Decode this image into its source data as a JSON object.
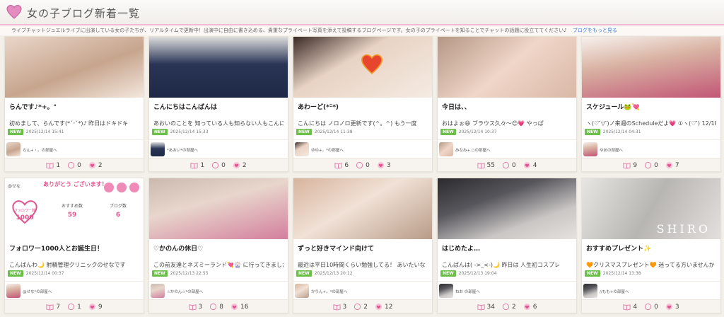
{
  "header": {
    "title": "女の子ブログ新着一覧"
  },
  "notice": {
    "text": "ライブチャットジュエルライブに出演している女の子たちが、リアルタイムで更新中！出演中に自由に書き込める、貴重なプライベート写真を添えて投稿するブログページです。女の子のプライベートを知ることでチャットの話題に役立ててください♪",
    "link": "ブログをもっと見る"
  },
  "posts": [
    {
      "title": "らんです♪*+。°",
      "excerpt": "初めまして、らんです(*ˊᵕˋ*)♪ 昨日はドキドキ",
      "badge": "NEW",
      "date": "2025/12/14 15:41",
      "author": "らん+・。の部屋へ",
      "views": "1",
      "comments": "0",
      "likes": "2"
    },
    {
      "title": "こんにちはこんばんは",
      "excerpt": "あおいのことを 知っている人も知らない人もこんに",
      "badge": "NEW",
      "date": "2025/12/14 15:33",
      "author": "*あおい*の部屋へ",
      "views": "1",
      "comments": "0",
      "likes": "2"
    },
    {
      "title": "あわーど(*ᵕ̈*)",
      "excerpt": "こんにちは ノロノロ更新です(^。^) もう一度",
      "badge": "NEW",
      "date": "2025/12/14 11:38",
      "author": "ゆゆ+。*の部屋へ",
      "views": "6",
      "comments": "0",
      "likes": "3"
    },
    {
      "title": "今日は、、",
      "excerpt": "おはよぉ😆 ブラウス久々～😊💗 やっぱ",
      "badge": "NEW",
      "date": "2025/12/14 10:37",
      "author": "みなみ+.○の部屋へ",
      "views": "55",
      "comments": "0",
      "likes": "4"
    },
    {
      "title": "スケジュール🐸💘",
      "excerpt": "ヽ(♡ ̄▽ ̄)ノ来週のScheduleだよ💗 ①ヽ(♡ ̄) 12/18日",
      "badge": "NEW",
      "date": "2025/12/14 04:31",
      "author": "ゆあの部屋へ",
      "views": "9",
      "comments": "0",
      "likes": "7"
    },
    {
      "title": "フォロワー1000人とお誕生日！",
      "excerpt": "こんばんわ🌙 射精管理クリニックのせなです",
      "badge": "NEW",
      "date": "2025/12/14 00:37",
      "author": "@せな*の部屋へ",
      "views": "7",
      "comments": "1",
      "likes": "9"
    },
    {
      "title": "♡かのんの休日♡",
      "excerpt": "この前友達とネズミーランド💘🎡 に行ってきました",
      "badge": "NEW",
      "date": "2025/12/13 22:55",
      "author": "☆かのん☆*の部屋へ",
      "views": "3",
      "comments": "8",
      "likes": "16"
    },
    {
      "title": "ずっと好きマインド向けて",
      "excerpt": "最近は平日10時間くらい勉強してる！ あいたいな",
      "badge": "NEW",
      "date": "2025/12/13 20:12",
      "author": "かりん+。*の部屋へ",
      "views": "3",
      "comments": "2",
      "likes": "12"
    },
    {
      "title": "はじめたよ…",
      "excerpt": "こんばんは( ->_<-)🌙 昨日は 人生初コスプレ",
      "badge": "NEW",
      "date": "2025/12/13 19:04",
      "author": "ねお の部屋へ",
      "views": "34",
      "comments": "2",
      "likes": "6"
    },
    {
      "title": "おすすめプレゼント✨",
      "excerpt": "🧡クリスマスプレゼント🧡 迷ってる方いませんか",
      "badge": "NEW",
      "date": "2025/12/14 13:38",
      "author": "//もも+の部屋へ",
      "views": "4",
      "comments": "0",
      "likes": "3"
    }
  ],
  "follow_card": {
    "user": "@せな",
    "thanks": "ありがとう ございます！",
    "followers_label": "フォロワー数",
    "followers": "1000",
    "recommend_label": "おすすめ数",
    "recommend": "59",
    "blog_label": "ブログ数",
    "blog": "6"
  },
  "shiro_text": "SHIRO",
  "colors": {
    "accent": "#f0b9d3",
    "new_badge": "#6cc04a",
    "pink": "#e0558f"
  }
}
